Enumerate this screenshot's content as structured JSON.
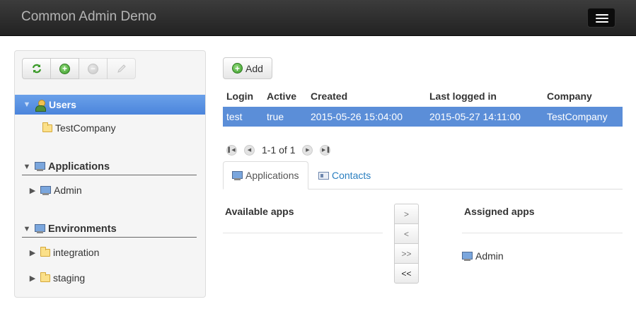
{
  "navbar": {
    "brand": "Common Admin Demo",
    "menu_icon": "hamburger-icon"
  },
  "toolbar": {
    "buttons": [
      {
        "icon": "refresh-icon",
        "enabled": true
      },
      {
        "icon": "add-icon",
        "enabled": true
      },
      {
        "icon": "remove-icon",
        "enabled": false
      },
      {
        "icon": "edit-icon",
        "enabled": false
      }
    ]
  },
  "tree": {
    "users": {
      "label": "Users",
      "children": [
        "TestCompany"
      ]
    },
    "applications": {
      "label": "Applications",
      "children": [
        "Admin"
      ]
    },
    "environments": {
      "label": "Environments",
      "children": [
        "integration",
        "staging"
      ]
    }
  },
  "main": {
    "add_label": "Add",
    "table": {
      "columns": [
        "Login",
        "Active",
        "Created",
        "Last logged in",
        "Company"
      ],
      "rows": [
        [
          "test",
          "true",
          "2015-05-26 15:04:00",
          "2015-05-27 14:11:00",
          "TestCompany"
        ]
      ]
    },
    "pager": {
      "text": "1-1 of 1"
    },
    "tabs": [
      {
        "label": "Applications",
        "active": true
      },
      {
        "label": "Contacts",
        "active": false
      }
    ],
    "apps": {
      "available_label": "Available apps",
      "assigned_label": "Assigned apps",
      "move_buttons": [
        ">",
        "<",
        ">>",
        "<<"
      ],
      "assigned": [
        "Admin"
      ]
    }
  },
  "colors": {
    "selection": "#5b8ed8",
    "link": "#2a7fc0",
    "navbar": "#222222"
  }
}
